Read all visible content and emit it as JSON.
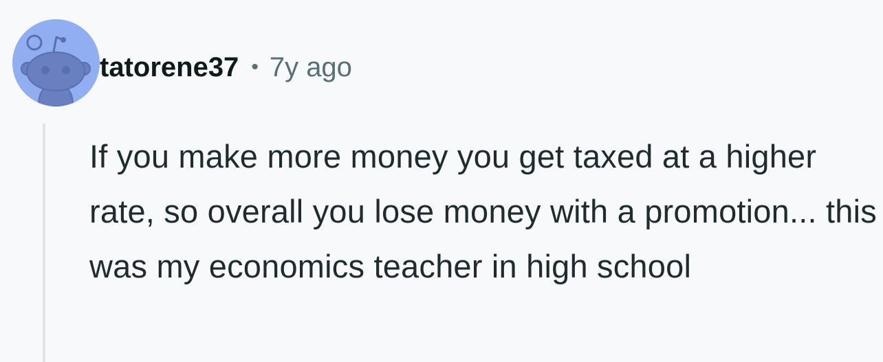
{
  "comment": {
    "author": "tatorene37",
    "separator": "•",
    "timestamp": "7y ago",
    "body": "If you make more money you get taxed at a higher rate, so overall you lose money with a promotion... this was my economics teacher in high school"
  },
  "avatar": {
    "icon": "snoo-avatar-icon",
    "background_color": "#92aef2",
    "figure_color": "#6a7fc0"
  },
  "colors": {
    "page_background": "#f7f9fa",
    "username": "#0f1a1c",
    "meta_text": "#576f76",
    "body_text": "#1f2b2e",
    "thread_line": "#dfe4e6"
  }
}
